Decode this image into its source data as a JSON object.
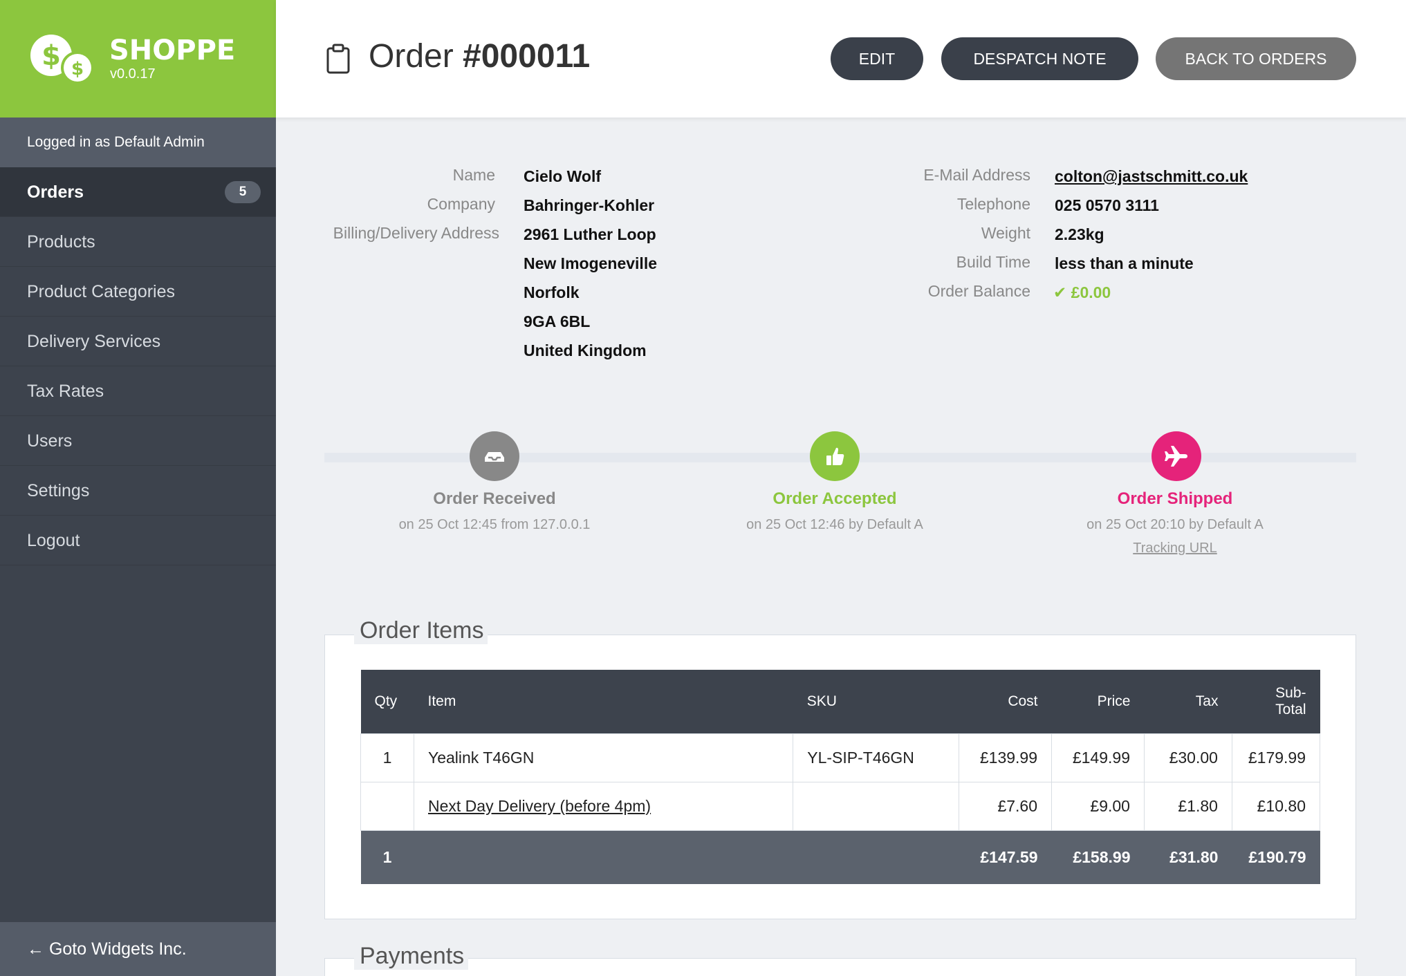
{
  "brand": {
    "name": "SHOPPE",
    "version": "v0.0.17"
  },
  "sidebar": {
    "logged_in": "Logged in as Default Admin",
    "items": [
      {
        "label": "Orders",
        "badge": "5",
        "active": true
      },
      {
        "label": "Products"
      },
      {
        "label": "Product Categories"
      },
      {
        "label": "Delivery Services"
      },
      {
        "label": "Tax Rates"
      },
      {
        "label": "Users"
      },
      {
        "label": "Settings"
      },
      {
        "label": "Logout"
      }
    ],
    "footer": "← Goto Widgets Inc."
  },
  "header": {
    "title_prefix": "Order ",
    "order_number": "#000011",
    "buttons": {
      "edit": "EDIT",
      "despatch": "DESPATCH NOTE",
      "back": "BACK TO ORDERS"
    }
  },
  "details": {
    "left": {
      "name_label": "Name",
      "name": "Cielo Wolf",
      "company_label": "Company",
      "company": "Bahringer-Kohler",
      "address_label": "Billing/Delivery Address",
      "address": [
        "2961 Luther Loop",
        "New Imogeneville",
        "Norfolk",
        "9GA 6BL",
        "United Kingdom"
      ]
    },
    "right": {
      "email_label": "E-Mail Address",
      "email": "colton@jastschmitt.co.uk",
      "phone_label": "Telephone",
      "phone": "025 0570 3111",
      "weight_label": "Weight",
      "weight": "2.23kg",
      "build_label": "Build Time",
      "build": "less than a minute",
      "balance_label": "Order Balance",
      "balance": "✔ £0.00"
    }
  },
  "timeline": [
    {
      "title": "Order Received",
      "sub": "on 25 Oct 12:45 from 127.0.0.1",
      "color": "#888888",
      "icon": "inbox-icon"
    },
    {
      "title": "Order Accepted",
      "sub": "on 25 Oct 12:46 by Default A",
      "color": "#8cc63e",
      "icon": "thumbs-up-icon"
    },
    {
      "title": "Order Shipped",
      "sub": "on 25 Oct 20:10 by Default A",
      "link": "Tracking URL",
      "color": "#e5237a",
      "icon": "airplane-icon"
    }
  ],
  "order_items": {
    "legend": "Order Items",
    "columns": [
      "Qty",
      "Item",
      "SKU",
      "Cost",
      "Price",
      "Tax",
      "Sub-\nTotal"
    ],
    "rows": [
      [
        "1",
        "Yealink T46GN",
        "YL-SIP-T46GN",
        "£139.99",
        "£149.99",
        "£30.00",
        "£179.99"
      ],
      [
        "",
        "Next Day Delivery (before 4pm)",
        "",
        "£7.60",
        "£9.00",
        "£1.80",
        "£10.80"
      ]
    ],
    "total": [
      "1",
      "",
      "",
      "£147.59",
      "£158.99",
      "£31.80",
      "£190.79"
    ]
  },
  "payments": {
    "legend": "Payments"
  },
  "colors": {
    "accent": "#8cc63e",
    "sidebar": "#3d434d",
    "shipped": "#e5237a"
  }
}
